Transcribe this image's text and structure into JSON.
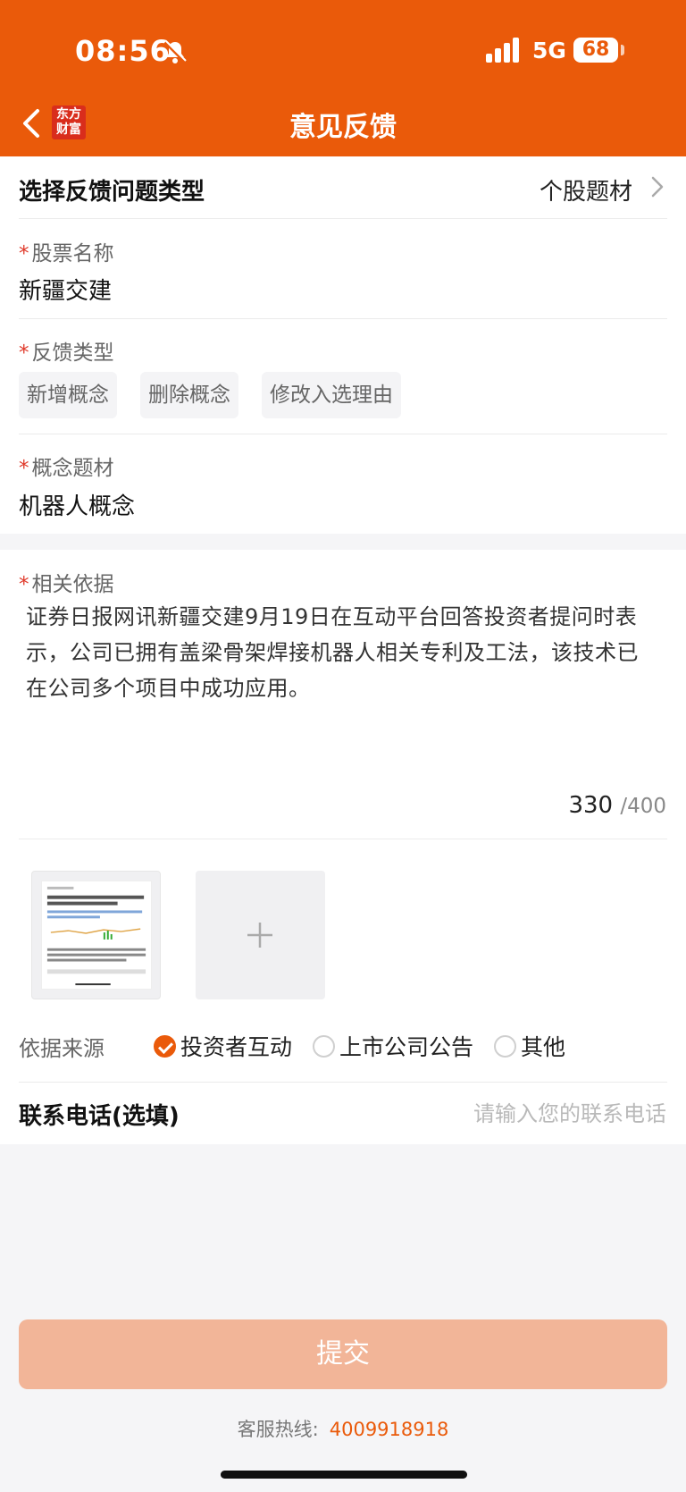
{
  "status_bar": {
    "time": "08:56",
    "network": "5G",
    "battery": "68"
  },
  "nav": {
    "logo_line1": "东方",
    "logo_line2": "财富",
    "title": "意见反馈"
  },
  "feedback_type_row": {
    "label": "选择反馈问题类型",
    "value": "个股题材"
  },
  "stock": {
    "label": "股票名称",
    "value": "新疆交建"
  },
  "feedback_kind": {
    "label": "反馈类型",
    "options": [
      "新增概念",
      "删除概念",
      "修改入选理由"
    ]
  },
  "concept": {
    "label": "概念题材",
    "value": "机器人概念"
  },
  "basis": {
    "label": "相关依据",
    "text": "证券日报网讯新疆交建9月19日在互动平台回答投资者提问时表示，公司已拥有盖梁骨架焊接机器人相关专利及工法，该技术已在公司多个项目中成功应用。",
    "count": "330",
    "max": "/400"
  },
  "source": {
    "label": "依据来源",
    "options": [
      "投资者互动",
      "上市公司公告",
      "其他"
    ],
    "selected": "投资者互动"
  },
  "phone": {
    "label": "联系电话(选填)",
    "placeholder": "请输入您的联系电话"
  },
  "submit_label": "提交",
  "hotline": {
    "label": "客服热线:",
    "number": "4009918918"
  },
  "colors": {
    "brand": "#ea5a0a",
    "submit_disabled": "#f2b598",
    "required_star": "#e0392a"
  },
  "icons": [
    "bell-slash-icon",
    "signal-icon",
    "battery-icon",
    "back-arrow-icon",
    "chevron-right-icon",
    "plus-icon",
    "check-icon"
  ]
}
